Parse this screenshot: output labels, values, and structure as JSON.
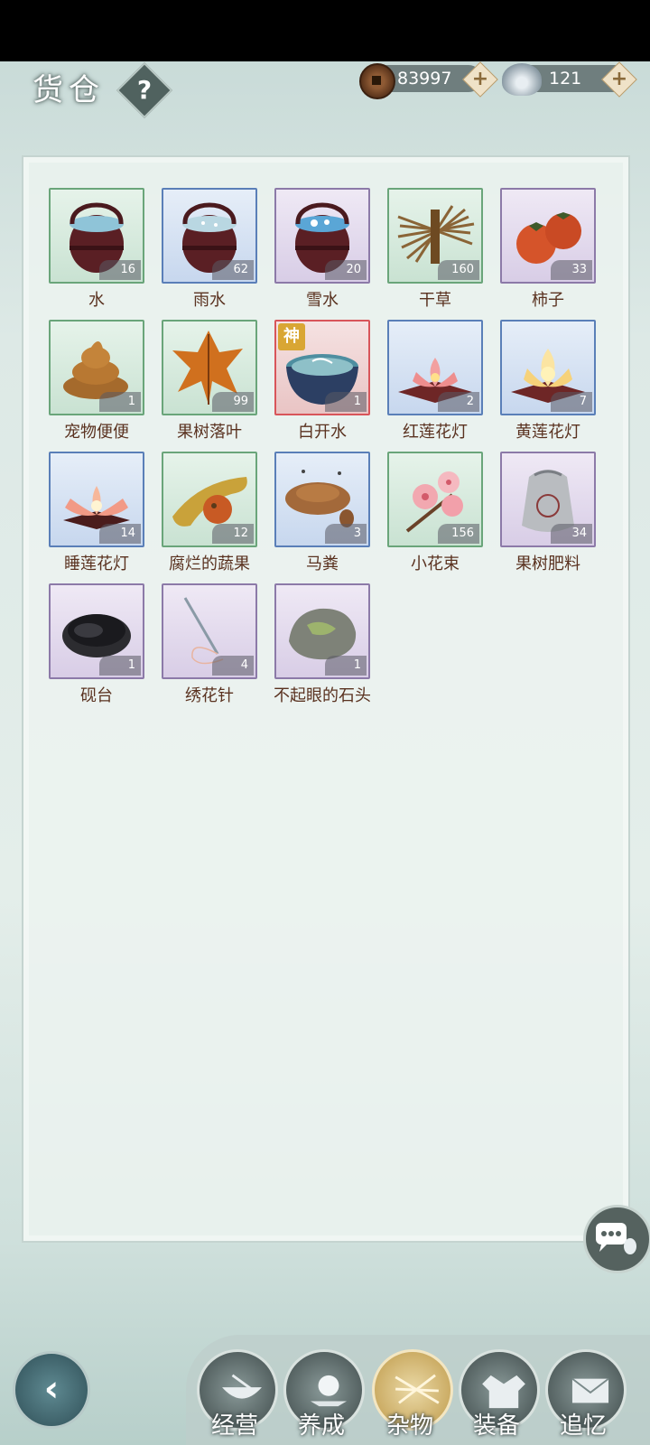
{
  "header": {
    "title": "货仓",
    "help_label": "?",
    "coins": "83997",
    "silver": "121",
    "plus": "+"
  },
  "items": [
    {
      "name": "水",
      "qty": "16",
      "rarity": "green",
      "icon": "water-bucket-icon"
    },
    {
      "name": "雨水",
      "qty": "62",
      "rarity": "blue",
      "icon": "rainwater-bucket-icon"
    },
    {
      "name": "雪水",
      "qty": "20",
      "rarity": "purple",
      "icon": "snowwater-bucket-icon"
    },
    {
      "name": "干草",
      "qty": "160",
      "rarity": "green",
      "icon": "hay-icon"
    },
    {
      "name": "柿子",
      "qty": "33",
      "rarity": "purple",
      "icon": "persimmon-icon"
    },
    {
      "name": "宠物便便",
      "qty": "1",
      "rarity": "green",
      "icon": "pet-poop-icon"
    },
    {
      "name": "果树落叶",
      "qty": "99",
      "rarity": "green",
      "icon": "fallen-leaf-icon"
    },
    {
      "name": "白开水",
      "qty": "1",
      "rarity": "red",
      "icon": "boiled-water-bowl-icon",
      "badge": "神"
    },
    {
      "name": "红莲花灯",
      "qty": "2",
      "rarity": "blue",
      "icon": "red-lotus-lamp-icon"
    },
    {
      "name": "黄莲花灯",
      "qty": "7",
      "rarity": "blue",
      "icon": "yellow-lotus-lamp-icon"
    },
    {
      "name": "睡莲花灯",
      "qty": "14",
      "rarity": "blue",
      "icon": "water-lily-lamp-icon"
    },
    {
      "name": "腐烂的蔬果",
      "qty": "12",
      "rarity": "green",
      "icon": "rotten-produce-icon"
    },
    {
      "name": "马粪",
      "qty": "3",
      "rarity": "blue",
      "icon": "horse-manure-icon"
    },
    {
      "name": "小花束",
      "qty": "156",
      "rarity": "green",
      "icon": "flower-bouquet-icon"
    },
    {
      "name": "果树肥料",
      "qty": "34",
      "rarity": "purple",
      "icon": "fertilizer-sack-icon"
    },
    {
      "name": "砚台",
      "qty": "1",
      "rarity": "purple",
      "icon": "inkstone-icon"
    },
    {
      "name": "绣花针",
      "qty": "4",
      "rarity": "purple",
      "icon": "embroidery-needle-icon"
    },
    {
      "name": "不起眼的石头",
      "qty": "1",
      "rarity": "purple",
      "icon": "plain-stone-icon"
    }
  ],
  "tabs": [
    {
      "label": "经营",
      "icon": "bowl-icon"
    },
    {
      "label": "养成",
      "icon": "pearl-icon"
    },
    {
      "label": "杂物",
      "icon": "hay-bundle-icon",
      "active": true
    },
    {
      "label": "装备",
      "icon": "robe-icon"
    },
    {
      "label": "追忆",
      "icon": "letter-icon"
    }
  ],
  "colors": {
    "green": "#6aa57a",
    "blue": "#5a7fb8",
    "purple": "#8c7aa8",
    "red": "#d8555a",
    "label": "#5a3220"
  }
}
